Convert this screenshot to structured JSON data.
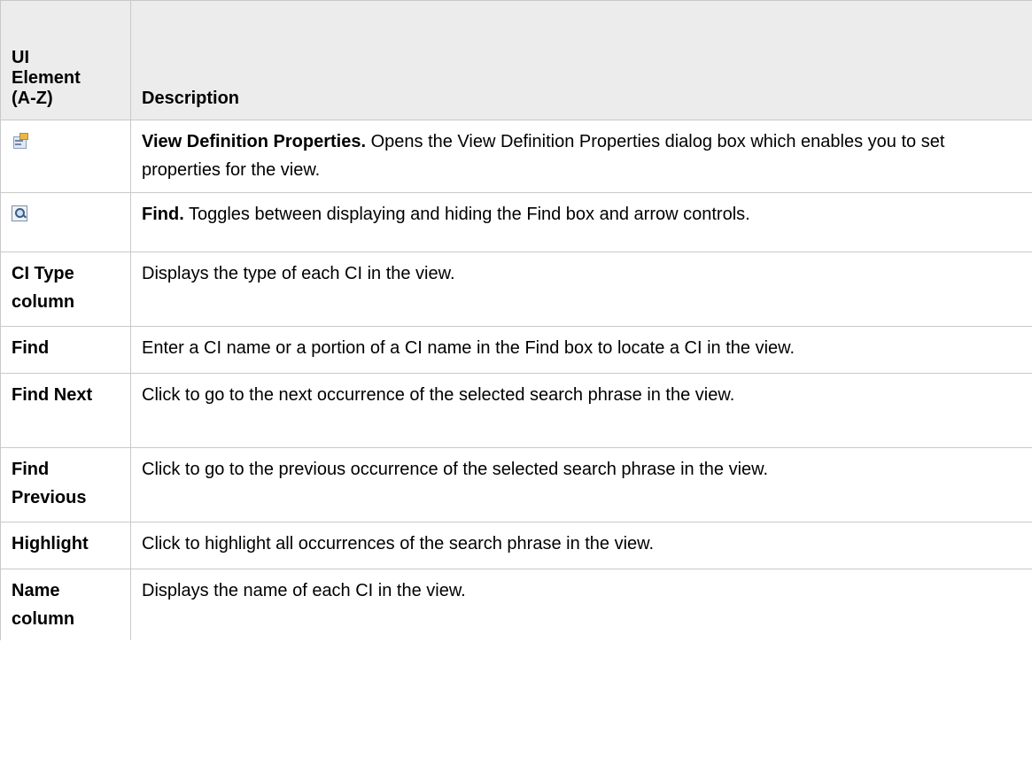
{
  "table": {
    "headers": {
      "col1": [
        "UI",
        "Element",
        "(A-Z)"
      ],
      "col2": "Description"
    },
    "rows": [
      {
        "icon": "view-definition-properties-icon",
        "desc_bold": "View Definition Properties.",
        "desc_text": " Opens the View Definition Properties dialog box which enables you to set properties for the view."
      },
      {
        "icon": "find-icon",
        "desc_bold": "Find.",
        "desc_text": " Toggles between displaying and hiding the Find box and arrow controls."
      },
      {
        "name": "CI Type column",
        "desc_text": "Displays the type of each CI in the view."
      },
      {
        "name": "Find",
        "desc_text": "Enter a CI name or a portion of a CI name in the Find box to locate a CI in the view."
      },
      {
        "name": "Find Next",
        "desc_text": "Click to go to the next occurrence of the selected search phrase in the view."
      },
      {
        "name": "Find Previous",
        "desc_text": "Click to go to the previous occurrence of the selected search phrase in the view."
      },
      {
        "name": "Highlight",
        "desc_text": "Click to highlight all occurrences of the search phrase in the view."
      },
      {
        "name": "Name column",
        "desc_text": "Displays the name of each CI in the view."
      }
    ]
  }
}
